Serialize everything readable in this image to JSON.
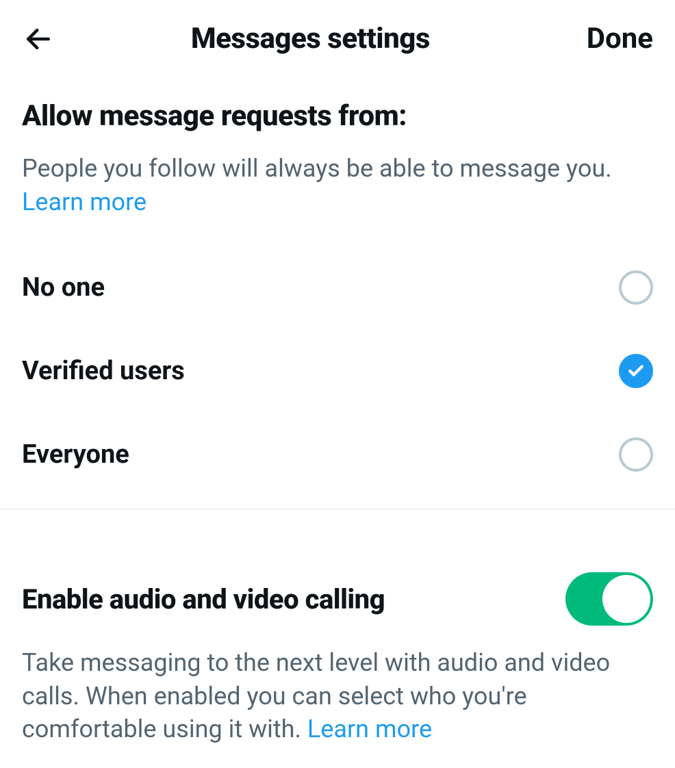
{
  "header": {
    "title": "Messages settings",
    "done_label": "Done"
  },
  "allow_section": {
    "title": "Allow message requests from:",
    "description": "People you follow will always be able to message you. ",
    "learn_more": "Learn more",
    "options": [
      {
        "label": "No one",
        "selected": false
      },
      {
        "label": "Verified users",
        "selected": true
      },
      {
        "label": "Everyone",
        "selected": false
      }
    ]
  },
  "calling_section": {
    "title": "Enable audio and video calling",
    "description": "Take messaging to the next level with audio and video calls. When enabled you can select who you're comfortable using it with. ",
    "learn_more": "Learn more",
    "enabled": true
  },
  "colors": {
    "accent_blue": "#1d9bf0",
    "toggle_green": "#00ba7c",
    "text_gray": "#536471",
    "border_gray": "#b9cad3"
  }
}
